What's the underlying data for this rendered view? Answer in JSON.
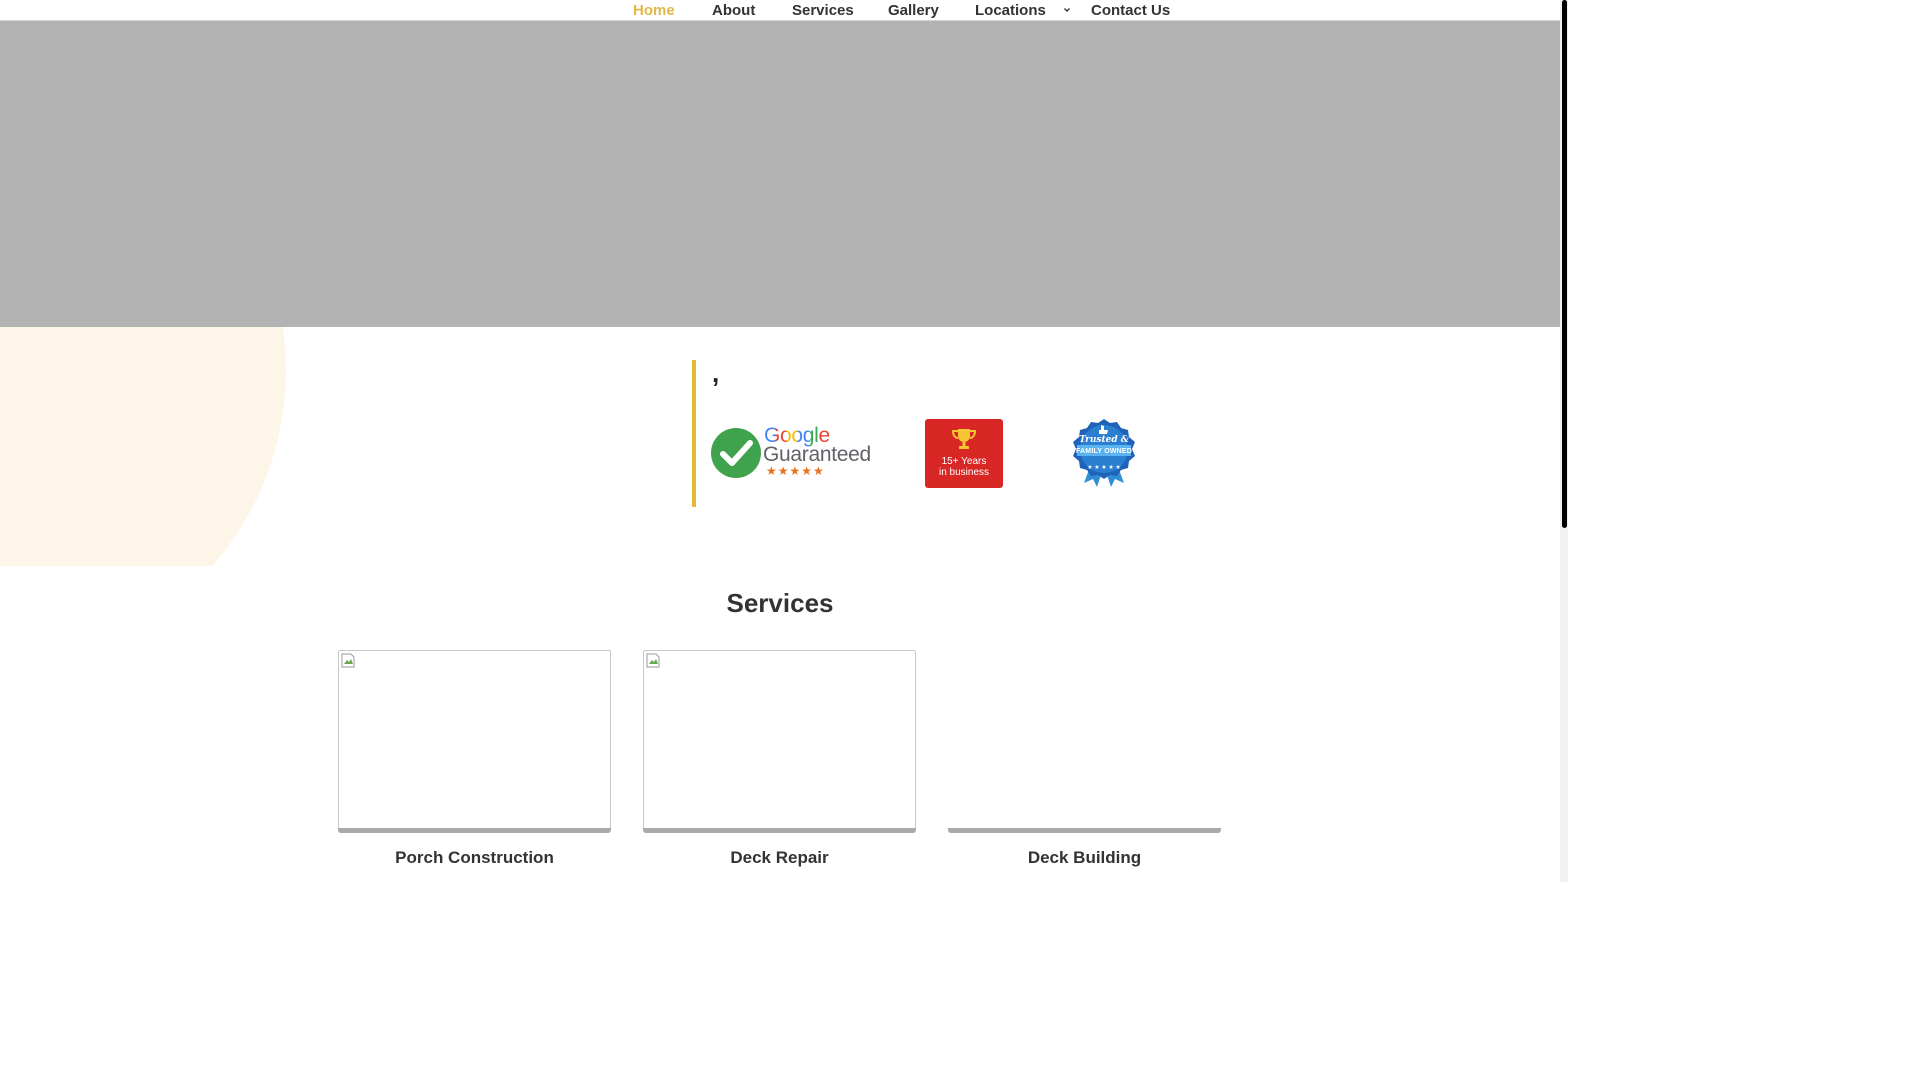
{
  "nav": {
    "items": [
      {
        "label": "Home",
        "active": true
      },
      {
        "label": "About",
        "active": false
      },
      {
        "label": "Services",
        "active": false
      },
      {
        "label": "Gallery",
        "active": false
      },
      {
        "label": "Locations",
        "active": false
      },
      {
        "label": "Contact Us",
        "active": false
      }
    ],
    "locations_dropdown_icon": "chevron-down-icon",
    "active_color": "#e0b84a"
  },
  "hero": {
    "color": "#b3b3b3"
  },
  "intro": {
    "comma": ","
  },
  "badges": {
    "google": {
      "brand": "Google",
      "label": "Guaranteed",
      "stars": "★★★★★",
      "icon": "check-icon"
    },
    "years": {
      "line1": "15+ Years",
      "line2": "in business",
      "icon": "trophy-icon",
      "color": "#d92726"
    },
    "family": {
      "line1": "Trusted &",
      "line2": "FAMILY OWNED",
      "icon": "thumbs-up-icon"
    }
  },
  "services": {
    "title": "Services",
    "cards": [
      {
        "label": "Porch Construction"
      },
      {
        "label": "Deck Repair"
      },
      {
        "label": "Deck Building"
      }
    ]
  }
}
